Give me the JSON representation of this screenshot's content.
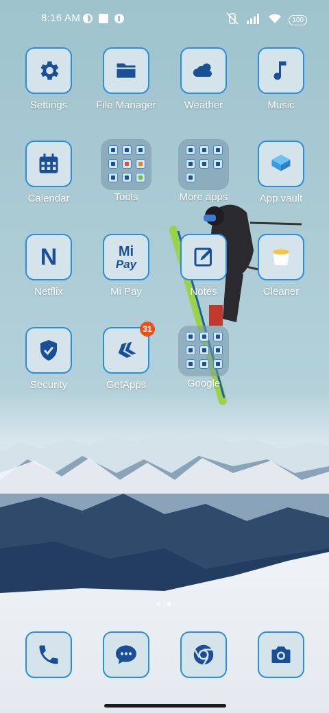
{
  "status_bar": {
    "time": "8:16 AM",
    "battery": "100",
    "icons": [
      "notification-icon",
      "square-icon",
      "notification-icon",
      "vibrate-off-icon",
      "signal-icon",
      "wifi-icon"
    ]
  },
  "apps": {
    "settings": "Settings",
    "file_manager": "File Manager",
    "weather": "Weather",
    "music": "Music",
    "calendar": "Calendar",
    "tools": "Tools",
    "more_apps": "More apps",
    "app_vault": "App vault",
    "netflix": "Netflix",
    "mi_pay": "Mi Pay",
    "notes": "Notes",
    "cleaner": "Cleaner",
    "security": "Security",
    "getapps": "GetApps",
    "google": "Google"
  },
  "icon_text": {
    "netflix": "N",
    "mi_top": "Mi",
    "mi_bottom": "Pay"
  },
  "badges": {
    "getapps": "31"
  },
  "page_indicator": {
    "pages": 2,
    "active": 2
  },
  "colors": {
    "icon_blue": "#1a4f96",
    "tile_border": "#2a8de0",
    "badge": "#e8531c"
  }
}
